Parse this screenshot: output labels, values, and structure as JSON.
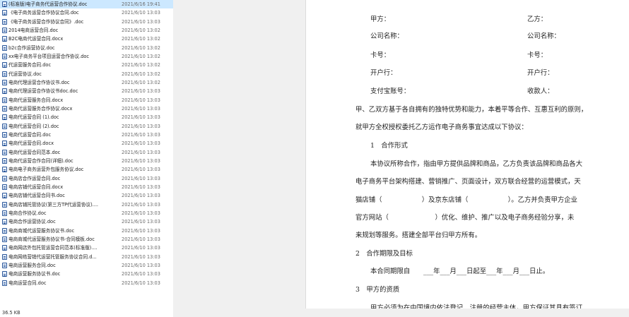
{
  "files": [
    {
      "name": "(标准版)电子商务代运营合作协议.doc",
      "date": "2021/6/16 19:41",
      "selected": true
    },
    {
      "name": "《电子商务运营合作协议合同.doc",
      "date": "2021/6/10 13:03"
    },
    {
      "name": "《电子商务运营合作协议合同》.doc",
      "date": "2021/6/10 13:03"
    },
    {
      "name": "2014电商运营合同.doc",
      "date": "2021/6/10 13:02"
    },
    {
      "name": "B2C电商代运营合同.docx",
      "date": "2021/6/10 13:02"
    },
    {
      "name": "b2c合作运营协议.doc",
      "date": "2021/6/10 13:02"
    },
    {
      "name": "xx电子商务平台项目运营合作协议.doc",
      "date": "2021/6/10 13:02"
    },
    {
      "name": "代运营服务合同.doc",
      "date": "2021/6/10 13:02"
    },
    {
      "name": "代运营协议.doc",
      "date": "2021/6/10 13:02"
    },
    {
      "name": "电商代理运营合作协议书.doc",
      "date": "2021/6/10 13:02"
    },
    {
      "name": "电商代理运营合作协议书doc.doc",
      "date": "2021/6/10 13:03"
    },
    {
      "name": "电商代运营服务合同.docx",
      "date": "2021/6/10 13:03"
    },
    {
      "name": "电商代运营服务合作协议.docx",
      "date": "2021/6/10 13:03"
    },
    {
      "name": "电商代运营合同 (1).doc",
      "date": "2021/6/10 13:03"
    },
    {
      "name": "电商代运营合同 (2).doc",
      "date": "2021/6/10 13:03"
    },
    {
      "name": "电商代运营合同.doc",
      "date": "2021/6/10 13:03"
    },
    {
      "name": "电商代运营合同.docx",
      "date": "2021/6/10 13:03"
    },
    {
      "name": "电商代运营合同范本.doc",
      "date": "2021/6/10 13:03"
    },
    {
      "name": "电商代运营合作合同(详细).doc",
      "date": "2021/6/10 13:03"
    },
    {
      "name": "电商电子商务运营外包服务协议.doc",
      "date": "2021/6/10 13:03"
    },
    {
      "name": "电商店合作运营合同.doc",
      "date": "2021/6/10 13:03"
    },
    {
      "name": "电商店铺代运营合同.docx",
      "date": "2021/6/10 13:03"
    },
    {
      "name": "电商店铺代运营合同书.doc",
      "date": "2021/6/10 13:03"
    },
    {
      "name": "电商店铺托管协议(第三方TP代运营协议)....",
      "date": "2021/6/10 13:03"
    },
    {
      "name": "电商合作协议.doc",
      "date": "2021/6/10 13:03"
    },
    {
      "name": "电商合作运营协议.doc",
      "date": "2021/6/10 13:03"
    },
    {
      "name": "电商商城代运营服务协议书.doc",
      "date": "2021/6/10 13:03"
    },
    {
      "name": "电商商城代运营服务协议书-合同模板.doc",
      "date": "2021/6/10 13:03"
    },
    {
      "name": "电商网店外包托管运营合同范本(标准版)....",
      "date": "2021/6/10 13:03"
    },
    {
      "name": "电商网络营销代运营托管服务协议合同.d...",
      "date": "2021/6/10 13:03"
    },
    {
      "name": "电商运营服务合同.doc",
      "date": "2021/6/10 13:03"
    },
    {
      "name": "电商运营服务协议书.doc",
      "date": "2021/6/10 13:03"
    },
    {
      "name": "电商运营合同.doc",
      "date": "2021/6/10 13:03"
    }
  ],
  "status": {
    "size": "36.5 KB"
  },
  "doc": {
    "party_a": "甲方：",
    "party_b": "乙方：",
    "company_a": "公司名称：",
    "company_b": "公司名称：",
    "card_a": "卡号：",
    "card_b": "卡号：",
    "bank_a": "开户行：",
    "bank_b": "开户行：",
    "alipay": "支付宝账号：",
    "payee": "收款人：",
    "intro1": "甲、乙双方基于各自拥有的独特优势和能力，本着平等合作、互惠互利的原则，",
    "intro2": "就甲方全权授权委托乙方运作电子商务事宜达成以下协议：",
    "s1_title": "1　合作形式",
    "s1_p1": "本协议所称合作，指由甲方提供品牌和商品，乙方负责该品牌和商品各大",
    "s1_p2": "电子商务平台架构搭建、营销推广、页面设计，双方联合经营的运营模式，天",
    "s1_p3": "猫店铺（　　　　　　）及京东店铺（　　　　　　）。乙方并负责甲方企业",
    "s1_p4": "官方网站（　　　　　　　）优化、维护、推广以及电子商务经验分享，未",
    "s1_p5": "来规划等服务。搭建全部平台归甲方所有。",
    "s2_title": "2　合作期限及目标",
    "s2_p1": "本合同期限自　　___年___月___日起至___年___月___日止。",
    "s3_title": "3　甲方的资质",
    "s3_p1": "甲方必须为在中国境内依法登记、注册的经营主体，甲方保证其具有签订"
  }
}
